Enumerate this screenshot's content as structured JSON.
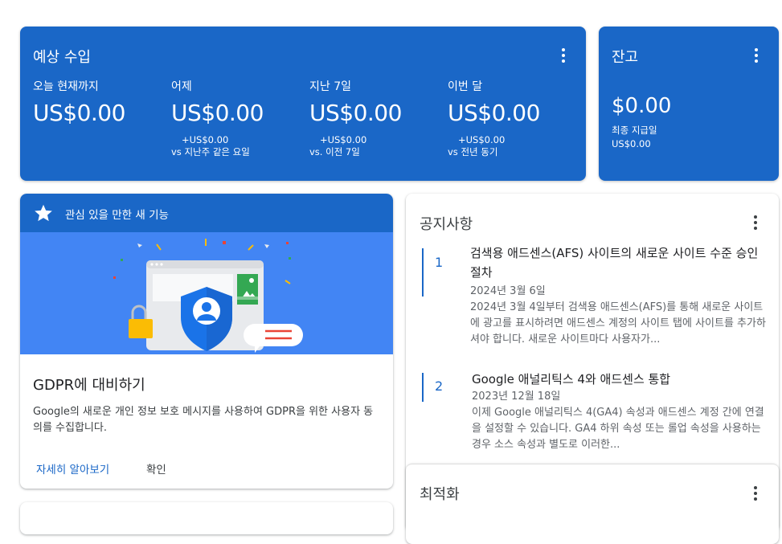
{
  "earnings": {
    "title": "예상 수입",
    "metrics": [
      {
        "label": "오늘 현재까지",
        "value": "US$0.00",
        "delta": "",
        "compare": ""
      },
      {
        "label": "어제",
        "value": "US$0.00",
        "delta": "+US$0.00",
        "compare": "vs 지난주 같은 요일"
      },
      {
        "label": "지난 7일",
        "value": "US$0.00",
        "delta": "+US$0.00",
        "compare": "vs. 이전 7일"
      },
      {
        "label": "이번 달",
        "value": "US$0.00",
        "delta": "+US$0.00",
        "compare": "vs 전년 동기"
      }
    ]
  },
  "balance": {
    "title": "잔고",
    "value": "$0.00",
    "last_payment_label": "최종 지급일",
    "last_payment_value": "US$0.00"
  },
  "feature": {
    "header": "관심 있을 만한 새 기능",
    "title": "GDPR에 대비하기",
    "description": "Google의 새로운 개인 정보 보호 메시지를 사용하여 GDPR을 위한 사용자 동의를 수집합니다.",
    "learn_more": "자세히 알아보기",
    "confirm": "확인"
  },
  "notices": {
    "title": "공지사항",
    "items": [
      {
        "num": "1",
        "title": "검색용 애드센스(AFS) 사이트의 새로운 사이트 수준 승인 절차",
        "date": "2024년 3월 6일",
        "text": "2024년 3월 4일부터 검색용 애드센스(AFS)를 통해 새로운 사이트에 광고를 표시하려면 애드센스 계정의 사이트 탭에 사이트를 추가하셔야 합니다. 새로운 사이트마다 사용자가..."
      },
      {
        "num": "2",
        "title": "Google 애널리틱스 4와 애드센스 통합",
        "date": "2023년 12월 18일",
        "text": "이제 Google 애널리틱스 4(GA4) 속성과 애드센스 계정 간에 연결을 설정할 수 있습니다. GA4 하위 속성 또는 롤업 속성을 사용하는 경우 소스 속성과 별도로 이러한..."
      }
    ]
  },
  "optimization": {
    "title": "최적화"
  },
  "colors": {
    "primary": "#1a67c7",
    "illustration_bg": "#4285f4"
  },
  "icons": {
    "menu": "more-vert-icon",
    "feature": "star-icon"
  }
}
